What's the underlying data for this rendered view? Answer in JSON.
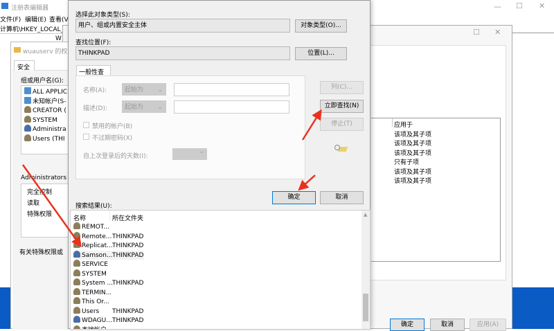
{
  "registry": {
    "title": "注册表编辑器",
    "menu": [
      "文件(F)",
      "编辑(E)",
      "查看(V)"
    ],
    "address": "计算机\\HKEY_LOCAL_M",
    "tree_item": "W"
  },
  "permissions": {
    "title": "wuauserv 的权",
    "tab": "安全",
    "group_label": "组或用户名(G):",
    "groups": [
      "ALL APPLIC",
      "未知帐户(S-",
      "CREATOR (",
      "SYSTEM",
      "Administra",
      "Users (THI"
    ],
    "perm_label": "Administrators",
    "perms": [
      "完全控制",
      "读取",
      "特殊权限"
    ],
    "footer": "有关特殊权限或"
  },
  "advanced": {
    "applies_header": "应用于",
    "applies": [
      "该项及其子项",
      "该项及其子项",
      "该项及其子项",
      "只有子项",
      "该项及其子项",
      "该项及其子项"
    ],
    "ok": "确定",
    "cancel": "取消",
    "apply": "应用(A)"
  },
  "select": {
    "type_label": "选择此对象类型(S):",
    "type_value": "用户、组或内置安全主体",
    "type_btn": "对象类型(O)...",
    "loc_label": "查找位置(F):",
    "loc_value": "THINKPAD",
    "loc_btn": "位置(L)...",
    "tab": "一般性查询",
    "name_label": "名称(A):",
    "name_mode": "起始为",
    "desc_label": "描述(D):",
    "desc_mode": "起始为",
    "disabled_acc": "禁用的帐户(B)",
    "no_expire": "不过期密码(X)",
    "days_label": "自上次登录后的天数(I):",
    "columns_btn": "列(C)...",
    "find_btn": "立即查找(N)",
    "stop_btn": "停止(T)",
    "ok": "确定",
    "cancel": "取消",
    "results_label": "搜索结果(U):",
    "col_name": "名称",
    "col_folder": "所在文件夹",
    "results": [
      {
        "name": "REMOT...",
        "folder": "",
        "icon": "group"
      },
      {
        "name": "Remote...",
        "folder": "THINKPAD",
        "icon": "group"
      },
      {
        "name": "Replicat...",
        "folder": "THINKPAD",
        "icon": "group"
      },
      {
        "name": "Samson...",
        "folder": "THINKPAD",
        "icon": "user"
      },
      {
        "name": "SERVICE",
        "folder": "",
        "icon": "group"
      },
      {
        "name": "SYSTEM",
        "folder": "",
        "icon": "group"
      },
      {
        "name": "System ...",
        "folder": "THINKPAD",
        "icon": "group"
      },
      {
        "name": "TERMIN...",
        "folder": "",
        "icon": "group"
      },
      {
        "name": "This Or...",
        "folder": "",
        "icon": "group"
      },
      {
        "name": "Users",
        "folder": "THINKPAD",
        "icon": "group"
      },
      {
        "name": "WDAGU...",
        "folder": "THINKPAD",
        "icon": "user"
      },
      {
        "name": "本地帐户",
        "folder": "",
        "icon": "group"
      }
    ]
  },
  "colors": {
    "accent": "#0078d7",
    "arrow": "#e8321e",
    "desktop": "#0a5bc4"
  }
}
